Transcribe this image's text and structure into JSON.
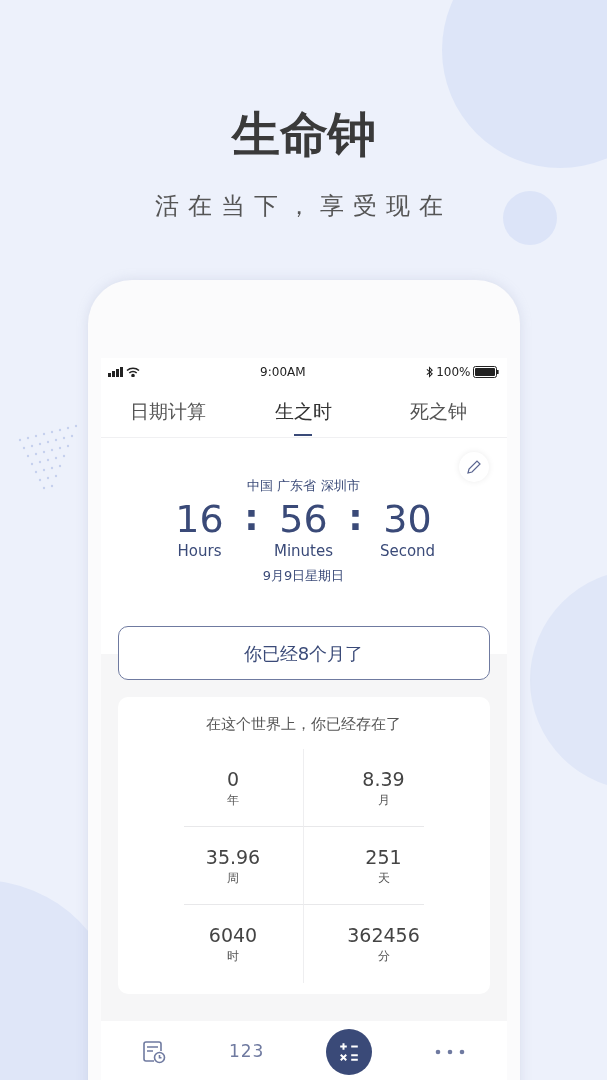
{
  "hero": {
    "title": "生命钟",
    "subtitle": "活在当下，享受现在"
  },
  "status_bar": {
    "time": "9:00AM",
    "battery": "100%"
  },
  "tabs": [
    {
      "label": "日期计算",
      "selected": false
    },
    {
      "label": "生之时",
      "selected": true
    },
    {
      "label": "死之钟",
      "selected": false
    }
  ],
  "clock": {
    "location": "中国 广东省 深圳市",
    "separator": ":",
    "units": [
      {
        "value": "16",
        "label": "Hours"
      },
      {
        "value": "56",
        "label": "Minutes"
      },
      {
        "value": "30",
        "label": "Second"
      }
    ],
    "date": "9月9日星期日"
  },
  "age_button": "你已经8个月了",
  "stats": {
    "title": "在这个世界上，你已经存在了",
    "items": [
      {
        "value": "0",
        "unit": "年"
      },
      {
        "value": "8.39",
        "unit": "月"
      },
      {
        "value": "35.96",
        "unit": "周"
      },
      {
        "value": "251",
        "unit": "天"
      },
      {
        "value": "6040",
        "unit": "时"
      },
      {
        "value": "362456",
        "unit": "分"
      }
    ]
  },
  "bottom_nav": [
    {
      "kind": "calendar"
    },
    {
      "kind": "text",
      "label": "123"
    },
    {
      "kind": "calculator"
    },
    {
      "kind": "more"
    }
  ]
}
